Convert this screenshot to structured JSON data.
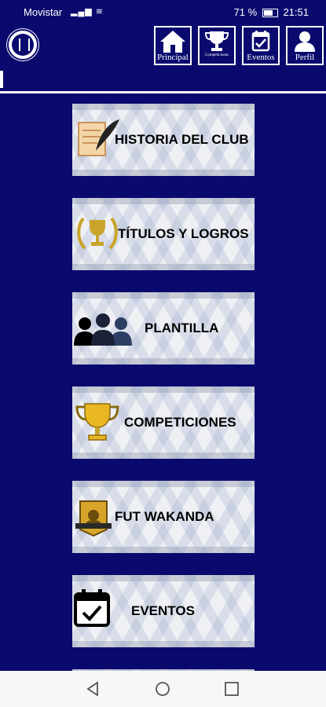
{
  "status_bar": {
    "carrier": "Movistar",
    "battery": "71 %",
    "time": "21:51"
  },
  "nav_tabs": [
    {
      "label": "Principal",
      "icon": "home-icon"
    },
    {
      "label": "Competiciones",
      "icon": "trophy-icon"
    },
    {
      "label": "Eventos",
      "icon": "calendar-check-icon"
    },
    {
      "label": "Perfil",
      "icon": "user-icon"
    }
  ],
  "menu": [
    {
      "label": "HISTORIA DEL CLUB",
      "icon": "scroll-quill-icon"
    },
    {
      "label": "TÍTULOS Y LOGROS",
      "icon": "laurel-trophy-icon"
    },
    {
      "label": "PLANTILLA",
      "icon": "people-silhouette-icon"
    },
    {
      "label": "COMPETICIONES",
      "icon": "gold-cup-icon"
    },
    {
      "label": "FUT WAKANDA",
      "icon": "player-card-icon"
    },
    {
      "label": "EVENTOS",
      "icon": "calendar-check-icon"
    }
  ],
  "colors": {
    "background": "#0a0a6e",
    "card": "#eef0f4"
  }
}
